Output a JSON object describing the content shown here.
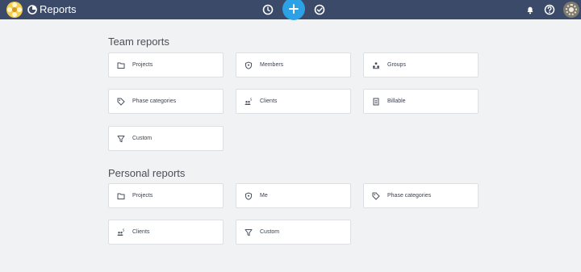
{
  "header": {
    "title": "Reports"
  },
  "sections": {
    "team": {
      "title": "Team reports",
      "items": [
        {
          "label": "Projects",
          "icon": "folder-icon"
        },
        {
          "label": "Members",
          "icon": "shield-icon"
        },
        {
          "label": "Groups",
          "icon": "groups-icon"
        },
        {
          "label": "Phase categories",
          "icon": "tag-icon"
        },
        {
          "label": "Clients",
          "icon": "clients-icon"
        },
        {
          "label": "Billable",
          "icon": "billable-icon"
        },
        {
          "label": "Custom",
          "icon": "filter-icon"
        }
      ]
    },
    "personal": {
      "title": "Personal reports",
      "items": [
        {
          "label": "Projects",
          "icon": "folder-icon"
        },
        {
          "label": "Me",
          "icon": "shield-icon"
        },
        {
          "label": "Phase categories",
          "icon": "tag-icon"
        },
        {
          "label": "Clients",
          "icon": "clients-icon"
        },
        {
          "label": "Custom",
          "icon": "filter-icon"
        }
      ]
    }
  },
  "colors": {
    "topbar": "#3b4a69",
    "accent": "#2da1e6",
    "background": "#f1f2f4"
  }
}
